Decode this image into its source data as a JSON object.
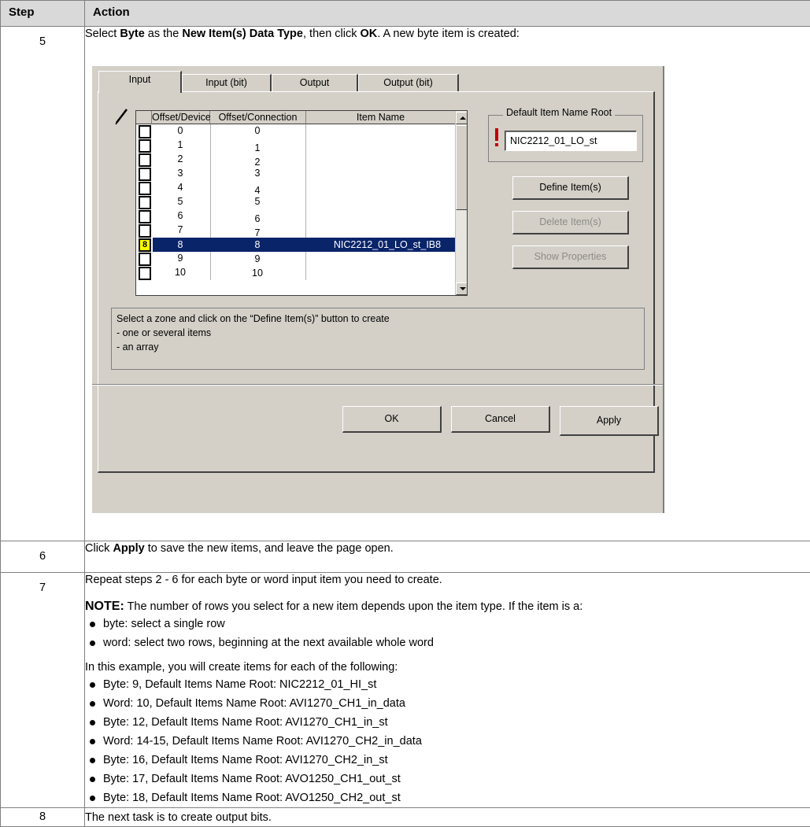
{
  "table": {
    "headers": {
      "step": "Step",
      "action": "Action"
    },
    "row5": {
      "step": "5",
      "t1": "Select ",
      "b1": "Byte",
      "t2": " as the ",
      "b2": "New Item(s) Data Type",
      "t3": ", then click ",
      "b3": "OK",
      "t4": ". A new byte item is created:"
    },
    "row6": {
      "step": "6",
      "t1": "Click ",
      "b1": "Apply",
      "t2": " to save the new items, and leave the page open."
    },
    "row7": {
      "step": "7",
      "line1": "Repeat steps 2 - 6 for each byte or word input item you need to create.",
      "note_label": "NOTE:",
      "note_text": " The number of rows you select for a new item depends upon the item type. If the item is a:",
      "note_items": [
        "byte: select a single row",
        "word: select two rows, beginning at the next available whole word"
      ],
      "example_intro": "In this example, you will create items for each of the following:",
      "example_items": [
        "Byte: 9, Default Items Name Root: NIC2212_01_HI_st",
        "Word: 10, Default Items Name Root: AVI1270_CH1_in_data",
        "Byte: 12, Default Items Name Root: AVI1270_CH1_in_st",
        "Word: 14-15, Default Items Name Root: AVI1270_CH2_in_data",
        "Byte: 16, Default Items Name Root: AVI1270_CH2_in_st",
        "Byte: 17, Default Items Name Root: AVO1250_CH1_out_st",
        "Byte: 18, Default Items Name Root: AVO1250_CH2_out_st"
      ]
    },
    "row8": {
      "step": "8",
      "text": "The next task is to create output bits."
    }
  },
  "dialog": {
    "tabs": [
      "Input",
      "Input (bit)",
      "Output",
      "Output (bit)"
    ],
    "columns": [
      "Offset/Device",
      "Offset/Connection",
      "Item Name"
    ],
    "rows": [
      {
        "checkbox": "",
        "device": "0",
        "connection": "0",
        "name": ""
      },
      {
        "checkbox": "",
        "device": "1",
        "connection": "1",
        "name": ""
      },
      {
        "checkbox": "",
        "device": "2",
        "connection": "2",
        "name": ""
      },
      {
        "checkbox": "",
        "device": "3",
        "connection": "3",
        "name": ""
      },
      {
        "checkbox": "",
        "device": "4",
        "connection": "4",
        "name": ""
      },
      {
        "checkbox": "",
        "device": "5",
        "connection": "5",
        "name": ""
      },
      {
        "checkbox": "",
        "device": "6",
        "connection": "6",
        "name": ""
      },
      {
        "checkbox": "",
        "device": "7",
        "connection": "7",
        "name": ""
      },
      {
        "checkbox": "8",
        "device": "8",
        "connection": "8",
        "name": "NIC2212_01_LO_st_IB8"
      },
      {
        "checkbox": "",
        "device": "9",
        "connection": "9",
        "name": ""
      },
      {
        "checkbox": "",
        "device": "10",
        "connection": "10",
        "name": ""
      }
    ],
    "root_group_label": "Default Item Name Root",
    "root_value": "NIC2212_01_LO_st",
    "buttons": {
      "define": "Define Item(s)",
      "delete": "Delete Item(s)",
      "properties": "Show Properties",
      "ok": "OK",
      "cancel": "Cancel",
      "apply": "Apply"
    },
    "info_lines": [
      "Select a zone and click on the “Define Item(s)” button to create",
      "- one or several items",
      "- an array"
    ],
    "colors": {
      "selection": "#0a246a",
      "checkbox_highlight": "#ffff00",
      "face": "#d4d0c8"
    }
  }
}
